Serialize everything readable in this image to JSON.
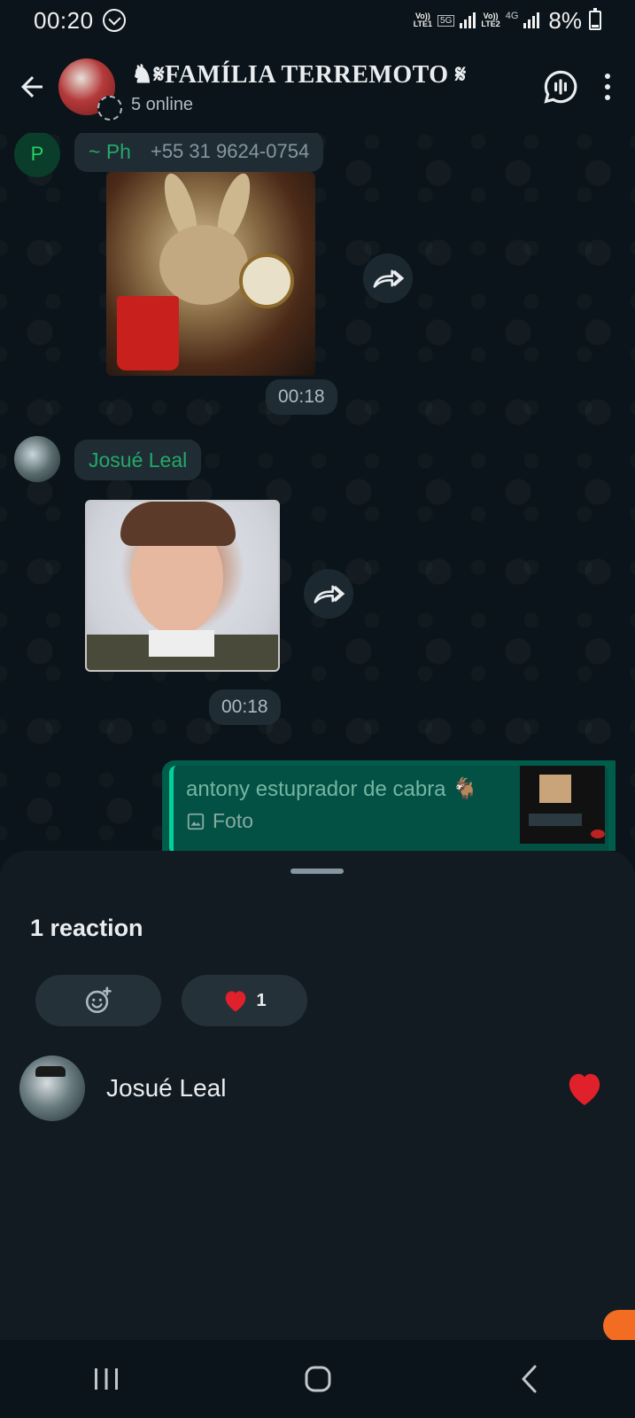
{
  "status_bar": {
    "time": "00:20",
    "sim1_label": "Vo))",
    "sim1_sub": "LTE1",
    "sim1_net": "5G",
    "sim2_label": "Vo))",
    "sim2_sub": "LTE2",
    "sim2_net": "4G",
    "battery": "8%"
  },
  "header": {
    "group_name": "♞𝄋FAMÍLIA TERREMOTO 𝄋",
    "subtitle": "5 online"
  },
  "messages": [
    {
      "sender_initial": "P",
      "sender_name": "~ Ph",
      "sender_phone": "+55 31 9624-0754",
      "type": "sticker",
      "time": "00:18"
    },
    {
      "sender_name": "Josué Leal",
      "type": "sticker",
      "time": "00:18"
    },
    {
      "type": "quote",
      "quote_title": "antony estuprador de cabra 🐐",
      "quote_sub": "Foto"
    }
  ],
  "sheet": {
    "title": "1 reaction",
    "tabs": [
      {
        "icon": "add-emoji-icon"
      },
      {
        "icon": "heart-icon",
        "count": "1"
      }
    ],
    "reactors": [
      {
        "name": "Josué Leal",
        "reaction": "heart-icon"
      }
    ]
  },
  "colors": {
    "background": "#0b141a",
    "bubble_out": "#005c4b",
    "sender_green": "#25a869",
    "sheet_bg": "#121b22",
    "heart": "#e0202a"
  }
}
